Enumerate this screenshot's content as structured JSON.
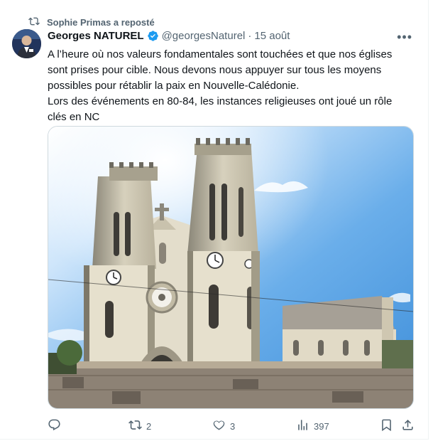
{
  "repost": {
    "text": "Sophie Primas a reposté",
    "icon": "repost-icon"
  },
  "author": {
    "name": "Georges NATUREL",
    "handle": "@georgesNaturel",
    "separator": "·",
    "date": "15 août",
    "verified_color": "#1d9bf0"
  },
  "tweet": {
    "lines": [
      "A l’heure où nos valeurs fondamentales sont touchées et que nos églises sont prises pour cible. Nous devons nous appuyer sur tous les moyens possibles pour rétablir la paix en Nouvelle-Calédonie.",
      "Lors des événements en 80-84, les instances religieuses ont joué un rôle clés en NC"
    ]
  },
  "media": {
    "subject": "cathedral-photo"
  },
  "actions": {
    "reply": {
      "icon": "reply-icon",
      "count": ""
    },
    "repost": {
      "icon": "repost-icon",
      "count": "2",
      "color": "#00ba7c"
    },
    "like": {
      "icon": "heart-icon",
      "count": "3"
    },
    "views": {
      "icon": "analytics-icon",
      "count": "397"
    },
    "bookmark": {
      "icon": "bookmark-icon"
    },
    "share": {
      "icon": "share-icon"
    }
  },
  "colors": {
    "text": "#0f1419",
    "secondary": "#536471",
    "accent": "#1d9bf0"
  }
}
